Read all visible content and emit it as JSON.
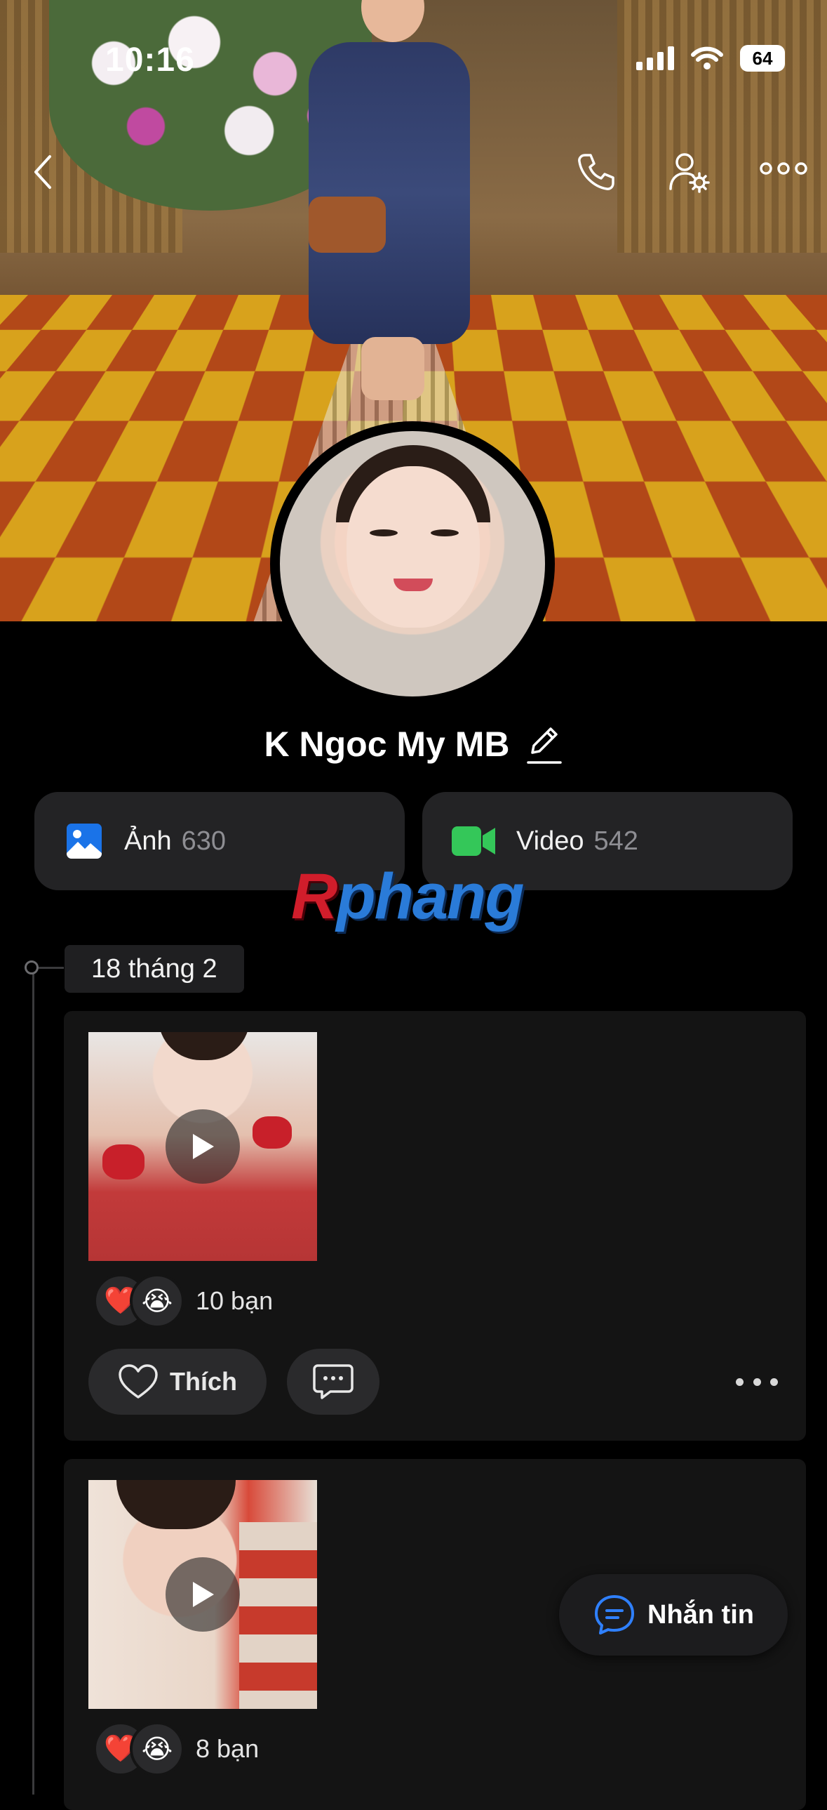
{
  "status_bar": {
    "time": "10:16",
    "battery": "64"
  },
  "profile": {
    "name": "K Ngoc My MB"
  },
  "media": [
    {
      "label": "Ảnh",
      "count": "630"
    },
    {
      "label": "Video",
      "count": "542"
    }
  ],
  "watermark": {
    "first": "R",
    "rest": "phang"
  },
  "timeline": {
    "date": "18 tháng 2"
  },
  "posts": [
    {
      "reactions": [
        "❤️",
        "😭"
      ],
      "reaction_count": "10 bạn",
      "like_label": "Thích"
    },
    {
      "reactions": [
        "❤️",
        "😭"
      ],
      "reaction_count": "8 bạn"
    }
  ],
  "fab": {
    "label": "Nhắn tin"
  },
  "colors": {
    "photo_icon": "#1a73e8",
    "video_icon": "#34c759",
    "accent": "#2f80ff"
  },
  "icons": [
    "back-icon",
    "phone-icon",
    "user-settings-icon",
    "more-icon",
    "edit-icon",
    "photo-icon",
    "video-icon",
    "play-icon",
    "heart-icon",
    "comment-icon",
    "message-icon"
  ]
}
